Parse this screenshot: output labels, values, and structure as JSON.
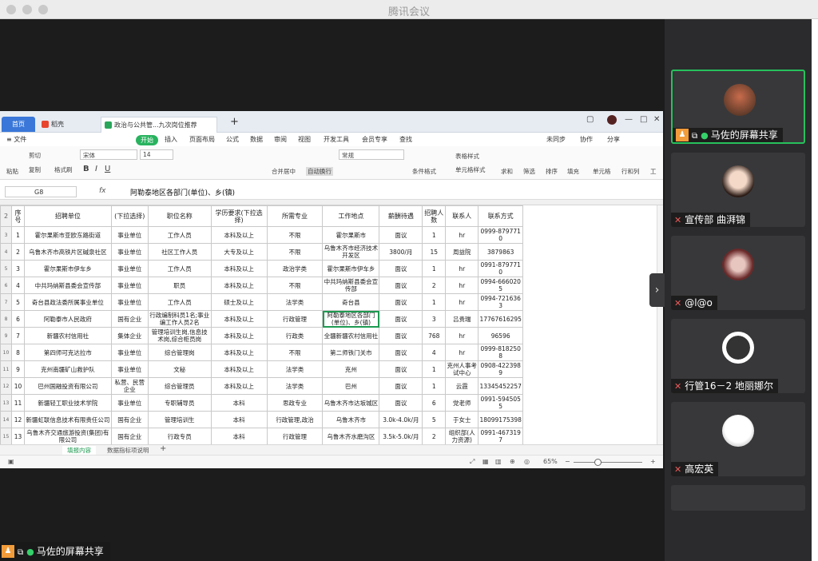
{
  "window": {
    "title": "腾讯会议"
  },
  "app": {
    "tabs": [
      {
        "label": "首页"
      },
      {
        "label": "稻壳"
      },
      {
        "label": "政治与公共管...九次岗位推荐"
      }
    ],
    "new_tab": "+",
    "menu": [
      "≡ 文件",
      "开始",
      "插入",
      "页面布局",
      "公式",
      "数据",
      "审阅",
      "视图",
      "开发工具",
      "会员专享",
      "查找"
    ],
    "menu_right": [
      "未同步",
      "协作",
      "分享"
    ],
    "ribbon": {
      "cut": "剪切",
      "copy": "复制",
      "format_painter": "格式刷",
      "paste": "粘贴",
      "font": "宋体",
      "size": "14",
      "merge": "合并居中",
      "wrap": "自动换行",
      "number_format": "常规",
      "conditional": "条件格式",
      "table_style": "表格样式",
      "cell_style": "单元格样式",
      "sum": "求和",
      "filter": "筛选",
      "sort": "排序",
      "fill": "填充",
      "cell": "单元格",
      "rowcol": "行和列",
      "worksheet": "工"
    },
    "formula_bar": {
      "cell_ref": "G8",
      "fx": "fx",
      "content": "阿勒泰地区各部门(单位)、乡(镇)"
    },
    "sheet": {
      "headers": [
        "序号",
        "招聘单位",
        "(下拉选择)",
        "职位名称",
        "学历要求(下拉选择)",
        "所需专业",
        "工作地点",
        "薪酬待遇",
        "招聘人数",
        "联系人",
        "联系方式"
      ],
      "rows": [
        [
          "1",
          "霍尔果斯市亚欧东路街道",
          "事业单位",
          "工作人员",
          "本科及以上",
          "不限",
          "霍尔果斯市",
          "面议",
          "1",
          "hr",
          "0999-8797710"
        ],
        [
          "2",
          "乌鲁木齐市高铁片区碱泉社区",
          "事业单位",
          "社区工作人员",
          "大专及以上",
          "不限",
          "乌鲁木齐市经济技术开发区",
          "3800/月",
          "15",
          "周益院",
          "3879863"
        ],
        [
          "3",
          "霍尔果斯市伊车乡",
          "事业单位",
          "工作人员",
          "本科及以上",
          "政治学类",
          "霍尔果斯市伊车乡",
          "面议",
          "1",
          "hr",
          "0991-8797710"
        ],
        [
          "4",
          "中共玛纳斯县委会宣传部",
          "事业单位",
          "职员",
          "本科及以上",
          "不限",
          "中共玛纳斯县委会宣传部",
          "面议",
          "2",
          "hr",
          "0994-6660205"
        ],
        [
          "5",
          "奇台县政法委所属事业单位",
          "事业单位",
          "工作人员",
          "硕士及以上",
          "法学类",
          "奇台县",
          "面议",
          "1",
          "hr",
          "0994-7216363"
        ],
        [
          "6",
          "阿勒泰市人民政府",
          "国有企业",
          "行政编制科员1名;事业编工作人员2名",
          "本科及以上",
          "行政管理",
          "阿勒泰地区各部门(单位)、乡(镇)",
          "面议",
          "3",
          "吕贵瑞",
          "17767616295"
        ],
        [
          "7",
          "新疆农村信用社",
          "集体企业",
          "管理培训生岗,信息技术岗,综合柜员岗",
          "本科及以上",
          "行政类",
          "全疆新疆农村信用社",
          "面议",
          "768",
          "hr",
          "96596"
        ],
        [
          "8",
          "第四师可克达拉市",
          "事业单位",
          "综合管理岗",
          "本科及以上",
          "不限",
          "第二师铁门关市",
          "面议",
          "4",
          "hr",
          "0999-8182508"
        ],
        [
          "9",
          "克州南疆矿山救护队",
          "事业单位",
          "文秘",
          "本科及以上",
          "法学类",
          "克州",
          "面议",
          "1",
          "克州人事考试中心",
          "0908-4223989"
        ],
        [
          "10",
          "巴州国融投资有限公司",
          "私营、民营企业",
          "综合管理员",
          "本科及以上",
          "法学类",
          "巴州",
          "面议",
          "1",
          "云霞",
          "13345452257"
        ],
        [
          "11",
          "新疆轻工职业技术学院",
          "事业单位",
          "专职辅导员",
          "本科",
          "思政专业",
          "乌鲁木齐市达坂城区",
          "面议",
          "6",
          "党老师",
          "0991-5945055"
        ],
        [
          "12",
          "新疆虹联信息技术有限责任公司",
          "国有企业",
          "管理培训生",
          "本科",
          "行政管理,政治",
          "乌鲁木齐市",
          "3.0k-4.0k/月",
          "5",
          "于女士",
          "18099175398"
        ],
        [
          "13",
          "乌鲁木齐交通旅游投资(集团)有限公司",
          "国有企业",
          "行政专员",
          "本科",
          "行政管理",
          "乌鲁木齐水磨沟区",
          "3.5k-5.0k/月",
          "2",
          "组织部(人力资源)",
          "0991-4673197"
        ]
      ]
    },
    "sheet_tabs": [
      "填报内容",
      "数据指标项说明"
    ],
    "zoom": "65%"
  },
  "participants": [
    {
      "name": "马佐的屏幕共享",
      "mic": "on",
      "sharing": true
    },
    {
      "name": "宣传部 曲湃锦",
      "mic": "off"
    },
    {
      "name": "@l@o",
      "mic": "off"
    },
    {
      "name": "行管16－2 地丽娜尔",
      "mic": "off"
    },
    {
      "name": "高宏英",
      "mic": "off"
    }
  ],
  "bottom_label": "马佐的屏幕共享",
  "colors": {
    "accent_green": "#27c15c",
    "wps_green": "#1f9a52",
    "home_blue": "#3a77d8"
  }
}
